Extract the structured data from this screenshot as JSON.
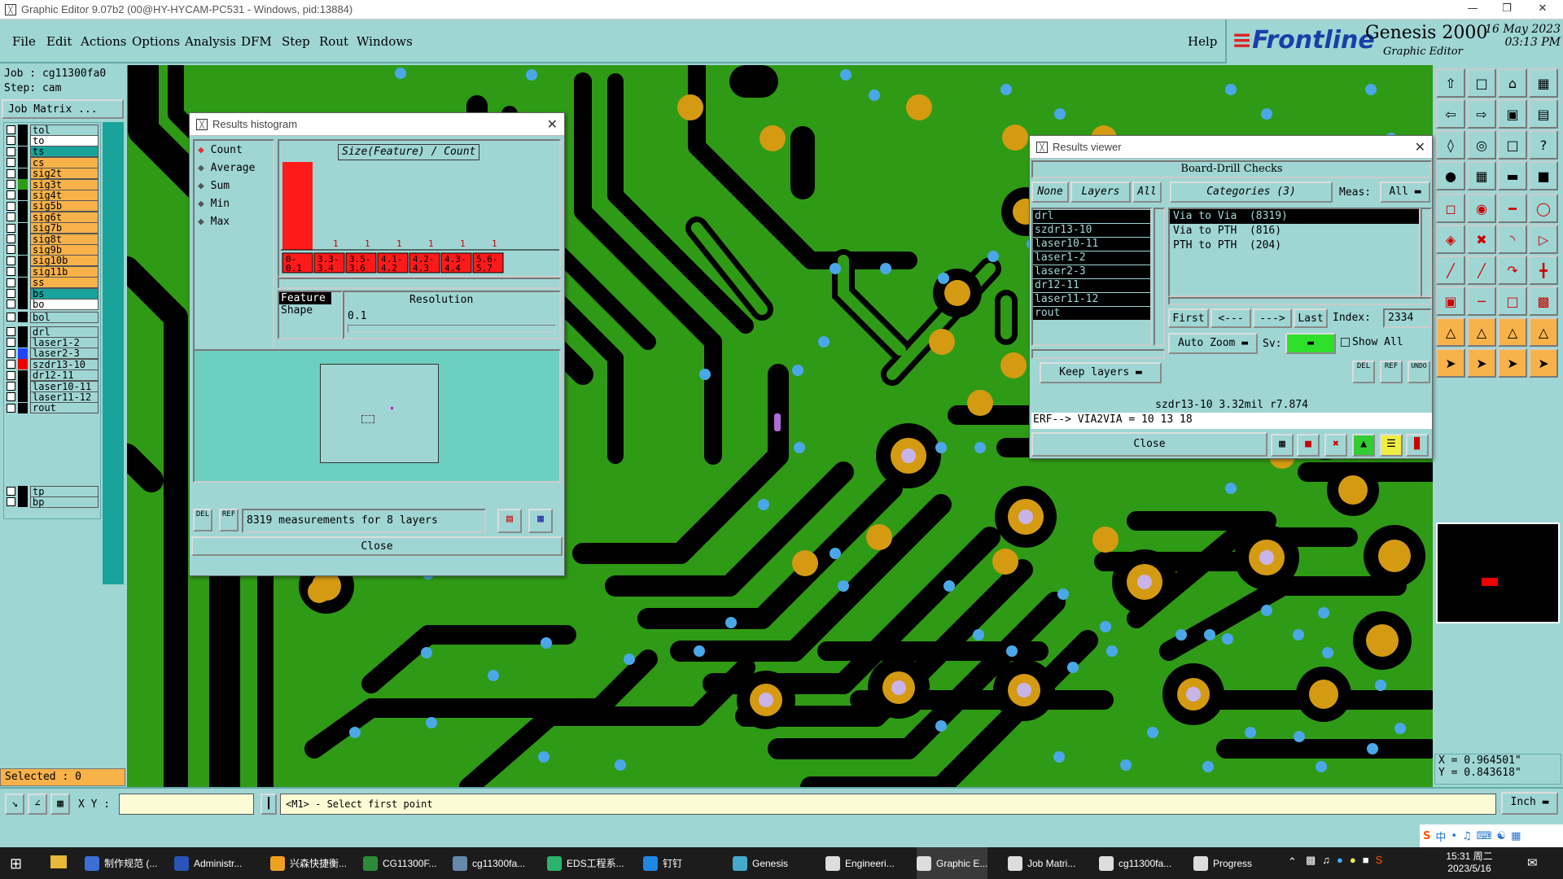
{
  "window_title": "Graphic Editor 9.07b2 (00@HY-HYCAM-PC531 - Windows, pid:13884)",
  "menu": [
    "File",
    "Edit",
    "Actions",
    "Options",
    "Analysis",
    "DFM",
    "Step",
    "Rout",
    "Windows"
  ],
  "help_label": "Help",
  "brand": {
    "logo": "Frontline",
    "product": "Genesis 2000",
    "sub": "Graphic Editor",
    "date": "16 May 2023",
    "time": "03:13 PM"
  },
  "job": {
    "job": "Job : cg11300fa0",
    "step": "Step: cam",
    "matrix_button": "Job Matrix ..."
  },
  "layers_top": [
    {
      "name": "tol",
      "color": "#9fd6d4",
      "sw": "#000"
    },
    {
      "name": "to",
      "color": "#fff",
      "sw": "#000"
    },
    {
      "name": "ts",
      "color": "#1aa39a",
      "sw": "#000"
    },
    {
      "name": "cs",
      "color": "#f7b24a",
      "sw": "#000"
    },
    {
      "name": "sig2t",
      "color": "#f7b24a",
      "sw": "#000"
    },
    {
      "name": "sig3t",
      "color": "#f7b24a",
      "sw": "#2f9a15"
    },
    {
      "name": "sig4t",
      "color": "#f7b24a",
      "sw": "#000"
    },
    {
      "name": "sig5b",
      "color": "#f7b24a",
      "sw": "#000"
    },
    {
      "name": "sig6t",
      "color": "#f7b24a",
      "sw": "#000"
    },
    {
      "name": "sig7b",
      "color": "#f7b24a",
      "sw": "#000"
    },
    {
      "name": "sig8t",
      "color": "#f7b24a",
      "sw": "#000"
    },
    {
      "name": "sig9b",
      "color": "#f7b24a",
      "sw": "#000"
    },
    {
      "name": "sig10b",
      "color": "#f7b24a",
      "sw": "#000"
    },
    {
      "name": "sig11b",
      "color": "#f7b24a",
      "sw": "#000"
    },
    {
      "name": "ss",
      "color": "#f7b24a",
      "sw": "#000"
    },
    {
      "name": "bs",
      "color": "#1aa39a",
      "sw": "#000"
    },
    {
      "name": "bo",
      "color": "#fff",
      "sw": "#000"
    }
  ],
  "layer_bol": "bol",
  "layers_drill": [
    {
      "name": "drl",
      "sw": "#000"
    },
    {
      "name": "laser1-2",
      "sw": "#000"
    },
    {
      "name": "laser2-3",
      "sw": "#2244ff"
    },
    {
      "name": "szdr13-10",
      "sw": "#e00"
    },
    {
      "name": "dr12-11",
      "sw": "#000"
    },
    {
      "name": "laser10-11",
      "sw": "#000"
    },
    {
      "name": "laser11-12",
      "sw": "#000"
    },
    {
      "name": "rout",
      "sw": "#000"
    }
  ],
  "layers_bottom": [
    "tp",
    "bp"
  ],
  "selected_label": "Selected : 0",
  "histogram": {
    "title": "Results histogram",
    "modes": [
      "Count",
      "Average",
      "Sum",
      "Min",
      "Max"
    ],
    "chart_title": "Size(Feature) / Count",
    "bars": [
      2973,
      1,
      1,
      1,
      1,
      1,
      1
    ],
    "bins": [
      "0- 0.1",
      "3.3- 3.4",
      "3.5- 3.6",
      "4.1- 4.2",
      "4.2- 4.3",
      "4.3- 4.4",
      "5.6- 5.7"
    ],
    "feature_label": "Feature",
    "shape_label": "Shape",
    "resolution_label": "Resolution",
    "resolution_value": "0.1",
    "summary": "8319 measurements for 8 layers",
    "close": "Close",
    "del": "DEL",
    "ref": "REF"
  },
  "results": {
    "title": "Results viewer",
    "header": "Board-Drill Checks",
    "none": "None",
    "layers": "Layers",
    "all": "All",
    "categories": "Categories (3)",
    "meas_label": "Meas:",
    "meas_value": "All",
    "layer_list": [
      "drl",
      "szdr13-10",
      "laser10-11",
      "laser1-2",
      "laser2-3",
      "dr12-11",
      "laser11-12",
      "rout"
    ],
    "category_list": [
      "Via to Via  (8319)",
      "Via to PTH  (816)",
      "PTH to PTH  (204)"
    ],
    "first": "First",
    "prev": "<---",
    "next": "--->",
    "last": "Last",
    "index_label": "Index:",
    "index_value": "2334",
    "auto_zoom": "Auto Zoom",
    "sv_label": "Sv:",
    "show_all": "Show All",
    "keep_layers": "Keep layers",
    "info": "szdr13-10 3.32mil  r7.874",
    "erf": "ERF--> VIA2VIA = 10 13 18",
    "close": "Close",
    "del": "DEL",
    "ref": "REF",
    "undo": "UNDO"
  },
  "coords": {
    "x": "X = 0.964501\"",
    "y": "Y = 0.843618\""
  },
  "cmd": {
    "xy_label": "X Y :",
    "prompt": "<M1> - Select first point",
    "units": "Inch"
  },
  "taskbar": {
    "items": [
      "制作规范 (...",
      "Administr...",
      "兴森快捷衡...",
      "CG11300F...",
      "cg11300fa...",
      "EDS工程系...",
      "钉钉",
      "Genesis",
      "Engineeri...",
      "Graphic E...",
      "Job Matri...",
      "cg11300fa...",
      "Progress"
    ],
    "time": "15:31 周二",
    "date": "2023/5/16",
    "ime": "中"
  },
  "colors": {
    "board": "#2f9a15",
    "ui": "#9fd6d4",
    "trace_clear": "#000000",
    "via_pad": "#d49a12",
    "drill": "#4aa8e8"
  }
}
